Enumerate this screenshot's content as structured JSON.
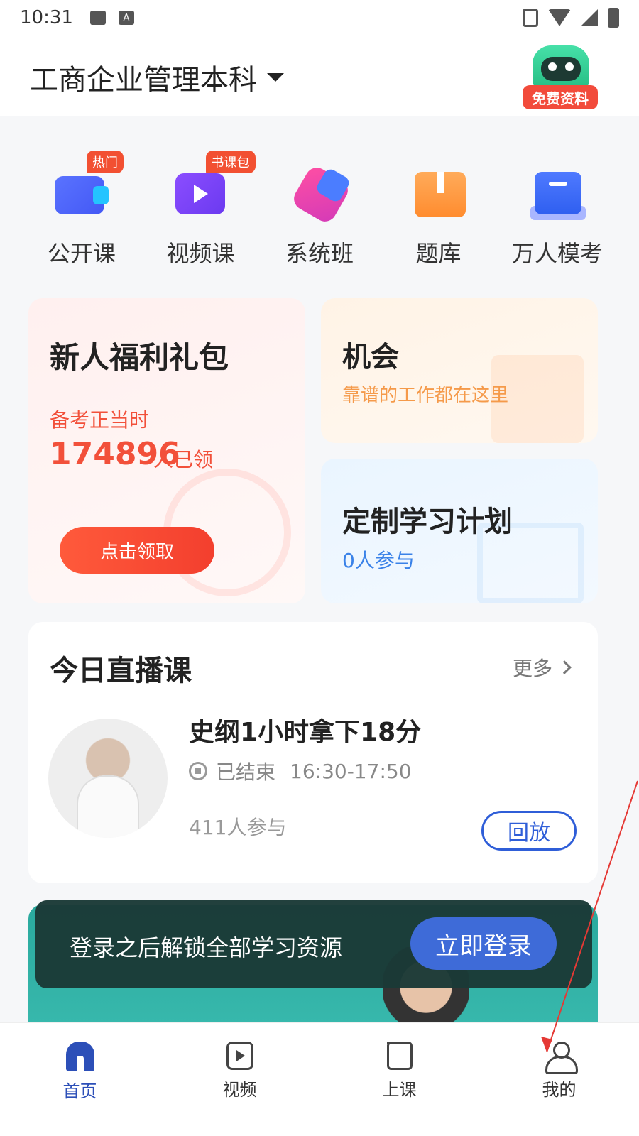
{
  "status_bar": {
    "time": "10:31",
    "icon_a": "A"
  },
  "header": {
    "title": "工商企业管理本科",
    "free_material_label": "免费资料"
  },
  "nav": [
    {
      "label": "公开课",
      "tag": "热门",
      "icon": "open-course-icon"
    },
    {
      "label": "视频课",
      "tag": "书课包",
      "icon": "video-course-icon"
    },
    {
      "label": "系统班",
      "tag": "",
      "icon": "system-class-icon"
    },
    {
      "label": "题库",
      "tag": "",
      "icon": "question-bank-icon"
    },
    {
      "label": "万人模考",
      "tag": "",
      "icon": "mock-exam-icon"
    }
  ],
  "gift_card": {
    "title": "新人福利礼包",
    "subtitle": "备考正当时",
    "count": "174896",
    "count_unit": "人已领",
    "button": "点击领取"
  },
  "chance_card": {
    "title": "机会",
    "subtitle": "靠谱的工作都在这里"
  },
  "plan_card": {
    "title": "定制学习计划",
    "subtitle": "0人参与"
  },
  "live": {
    "title": "今日直播课",
    "more": "更多",
    "course_title": "史纲1小时拿下18分",
    "status": "已结束",
    "time": "16:30-17:50",
    "participants": "411人参与",
    "replay": "回放"
  },
  "login_bar": {
    "message": "登录之后解锁全部学习资源",
    "button": "立即登录"
  },
  "tabbar": [
    {
      "label": "首页",
      "active": true
    },
    {
      "label": "视频",
      "active": false
    },
    {
      "label": "上课",
      "active": false
    },
    {
      "label": "我的",
      "active": false
    }
  ],
  "colors": {
    "accent": "#2c4fb8",
    "red": "#f2503a",
    "annotation_arrow": "#e53935"
  }
}
